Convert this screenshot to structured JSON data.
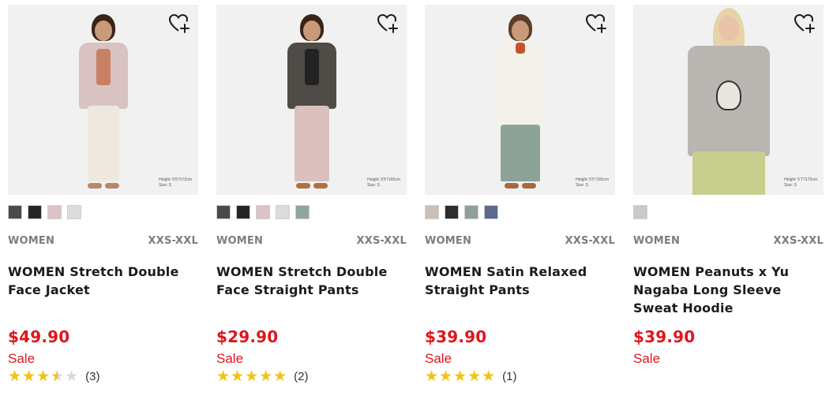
{
  "products": [
    {
      "category": "WOMEN",
      "size_range": "XXS-XXL",
      "name": "WOMEN Stretch Double Face Jacket",
      "price": "$49.90",
      "sale_label": "Sale",
      "rating": 3.5,
      "review_count": "(3)",
      "size_note_line1": "Height: 5'8\"/172cm",
      "size_note_line2": "Size: S",
      "swatches": [
        "#4a4a4a",
        "#252525",
        "#dcc3c6",
        "#dcdcdc"
      ],
      "image": {
        "hair": "#3a2418",
        "top": "#d8c3c2",
        "inner": "#c87f62",
        "bottom": "#eee9de",
        "shoe": "#b8876a"
      }
    },
    {
      "category": "WOMEN",
      "size_range": "XXS-XXL",
      "name": "WOMEN Stretch Double Face Straight Pants",
      "price": "$29.90",
      "sale_label": "Sale",
      "rating": 5,
      "review_count": "(2)",
      "size_note_line1": "Height: 5'5\"/165cm",
      "size_note_line2": "Size: S",
      "swatches": [
        "#4a4a4a",
        "#252525",
        "#dcc3c6",
        "#dcdcdc",
        "#8ea5a0"
      ],
      "image": {
        "hair": "#3a2418",
        "top": "#4f4b47",
        "inner": "#222222",
        "bottom": "#dcc0bd",
        "shoe": "#b0713f"
      }
    },
    {
      "category": "WOMEN",
      "size_range": "XXS-XXL",
      "name": "WOMEN Satin Relaxed Straight Pants",
      "price": "$39.90",
      "sale_label": "Sale",
      "rating": 5,
      "review_count": "(1)",
      "size_note_line1": "Height: 5'5\"/165cm",
      "size_note_line2": "Size: S",
      "swatches": [
        "#cbbfb6",
        "#2d2d2d",
        "#8fa09c",
        "#5a6a8f"
      ],
      "image": {
        "hair": "#5a3d2a",
        "top": "#f3f1ea",
        "inner": "#c8502f",
        "bottom": "#8ea398",
        "shoe": "#a8693f"
      }
    },
    {
      "category": "WOMEN",
      "size_range": "XXS-XXL",
      "name": "WOMEN Peanuts x Yu Nagaba Long Sleeve Sweat Hoodie",
      "price": "$39.90",
      "sale_label": "Sale",
      "rating": null,
      "review_count": "",
      "size_note_line1": "Height: 5'7\"/170cm",
      "size_note_line2": "Size: S",
      "swatches": [
        "#c9c9c9"
      ],
      "image": {
        "hair": "#e7d3a8",
        "top": "#b9b6b1",
        "inner": "#b9b6b1",
        "bottom": "#c8cf8e",
        "shoe": "#c8cf8e"
      }
    }
  ],
  "icons": {
    "wishlist": "heart-plus-icon",
    "star": "star-icon"
  },
  "colors": {
    "price_red": "#e0161b",
    "star_gold": "#f0c315",
    "star_empty": "#d9d9d9",
    "meta_gray": "#7d7d7d"
  }
}
